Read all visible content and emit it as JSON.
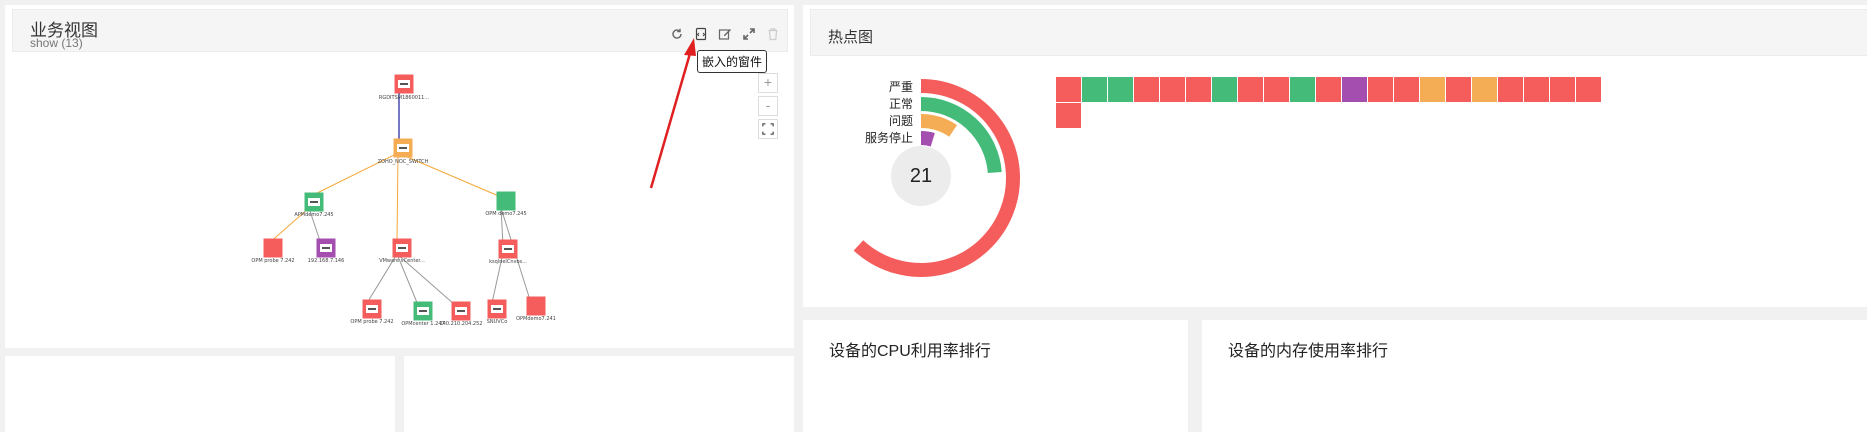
{
  "business_view": {
    "title": "业务视图",
    "subtitle": "show (13)",
    "tooltip": "嵌入的窗件",
    "zoom_in": "+",
    "zoom_out": "-",
    "nodes": [
      {
        "label": "RGDITSM1860011...",
        "color": "#f55d5d",
        "icon": "server-icon"
      },
      {
        "label": "ZOHO_NOC_SWITCH",
        "color": "#f5ad55",
        "icon": "switch-icon"
      },
      {
        "label": "APMdemo7.245",
        "color": "#45bb7a",
        "icon": "windows-server-icon"
      },
      {
        "label": "OPM demo7.245",
        "color": "#45bb7a",
        "icon": "device-icon"
      },
      {
        "label": "OPM probe 7.242",
        "color": "#f55d5d",
        "icon": "device-icon"
      },
      {
        "label": "192.168.7.146",
        "color": "#a44fb0",
        "icon": "linux-icon"
      },
      {
        "label": "VMware vCenter...",
        "color": "#f55d5d",
        "icon": "vmware-icon"
      },
      {
        "label": "ksqlnelCnvos...",
        "color": "#f55d5d",
        "icon": "printer-icon"
      },
      {
        "label": "OPM probe 7.242",
        "color": "#f55d5d",
        "icon": "server-icon"
      },
      {
        "label": "OPMcenter 1.247",
        "color": "#45bb7a",
        "icon": "windows-server-icon"
      },
      {
        "label": "140.210.204.252",
        "color": "#f55d5d",
        "icon": "server-icon"
      },
      {
        "label": "SNUVCo",
        "color": "#f55d5d",
        "icon": "linux-icon"
      },
      {
        "label": "OPMdemo7.241",
        "color": "#f55d5d",
        "icon": "device-icon"
      }
    ]
  },
  "heatmap": {
    "title": "热点图",
    "total": "21",
    "legend": [
      "严重",
      "正常",
      "问题",
      "服务停止"
    ],
    "colors": {
      "critical": "#f55d5d",
      "clear": "#45bb7a",
      "trouble": "#f5ad55",
      "down": "#a44fb0"
    },
    "ring_values": {
      "critical": 13,
      "clear": 5,
      "trouble": 2,
      "down": 1
    },
    "cells": [
      "critical",
      "clear",
      "clear",
      "critical",
      "critical",
      "critical",
      "clear",
      "critical",
      "critical",
      "clear",
      "critical",
      "down",
      "critical",
      "critical",
      "trouble",
      "critical",
      "trouble",
      "critical",
      "critical",
      "critical",
      "critical",
      "critical"
    ]
  },
  "cpu_card": {
    "title": "设备的CPU利用率排行"
  },
  "mem_card": {
    "title": "设备的内存使用率排行"
  }
}
